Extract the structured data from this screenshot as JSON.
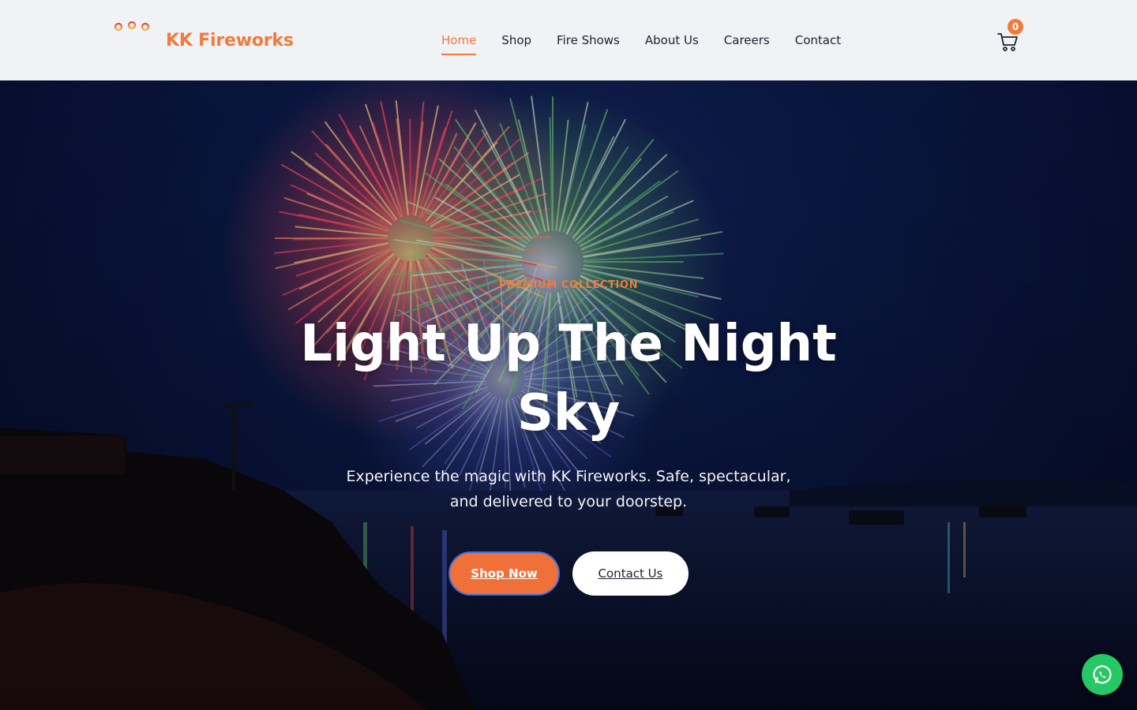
{
  "header": {
    "brand_name": "KK Fireworks",
    "nav": [
      {
        "label": "Home",
        "active": true
      },
      {
        "label": "Shop",
        "active": false
      },
      {
        "label": "Fire Shows",
        "active": false
      },
      {
        "label": "About Us",
        "active": false
      },
      {
        "label": "Careers",
        "active": false
      },
      {
        "label": "Contact",
        "active": false
      }
    ],
    "cart_count": "0",
    "cart_icon": "shopping-cart-icon"
  },
  "hero": {
    "eyebrow": "PREMIUM COLLECTION",
    "title": "Light Up The Night Sky",
    "subtitle": "Experience the magic with KK Fireworks. Safe, spectacular, and delivered to your doorstep.",
    "primary_button": "Shop Now",
    "secondary_button": "Contact Us"
  },
  "floating": {
    "whatsapp_icon": "whatsapp-icon"
  },
  "colors": {
    "accent": "#f07b3a",
    "header_bg": "#f1f2f5",
    "whatsapp": "#25c864"
  }
}
